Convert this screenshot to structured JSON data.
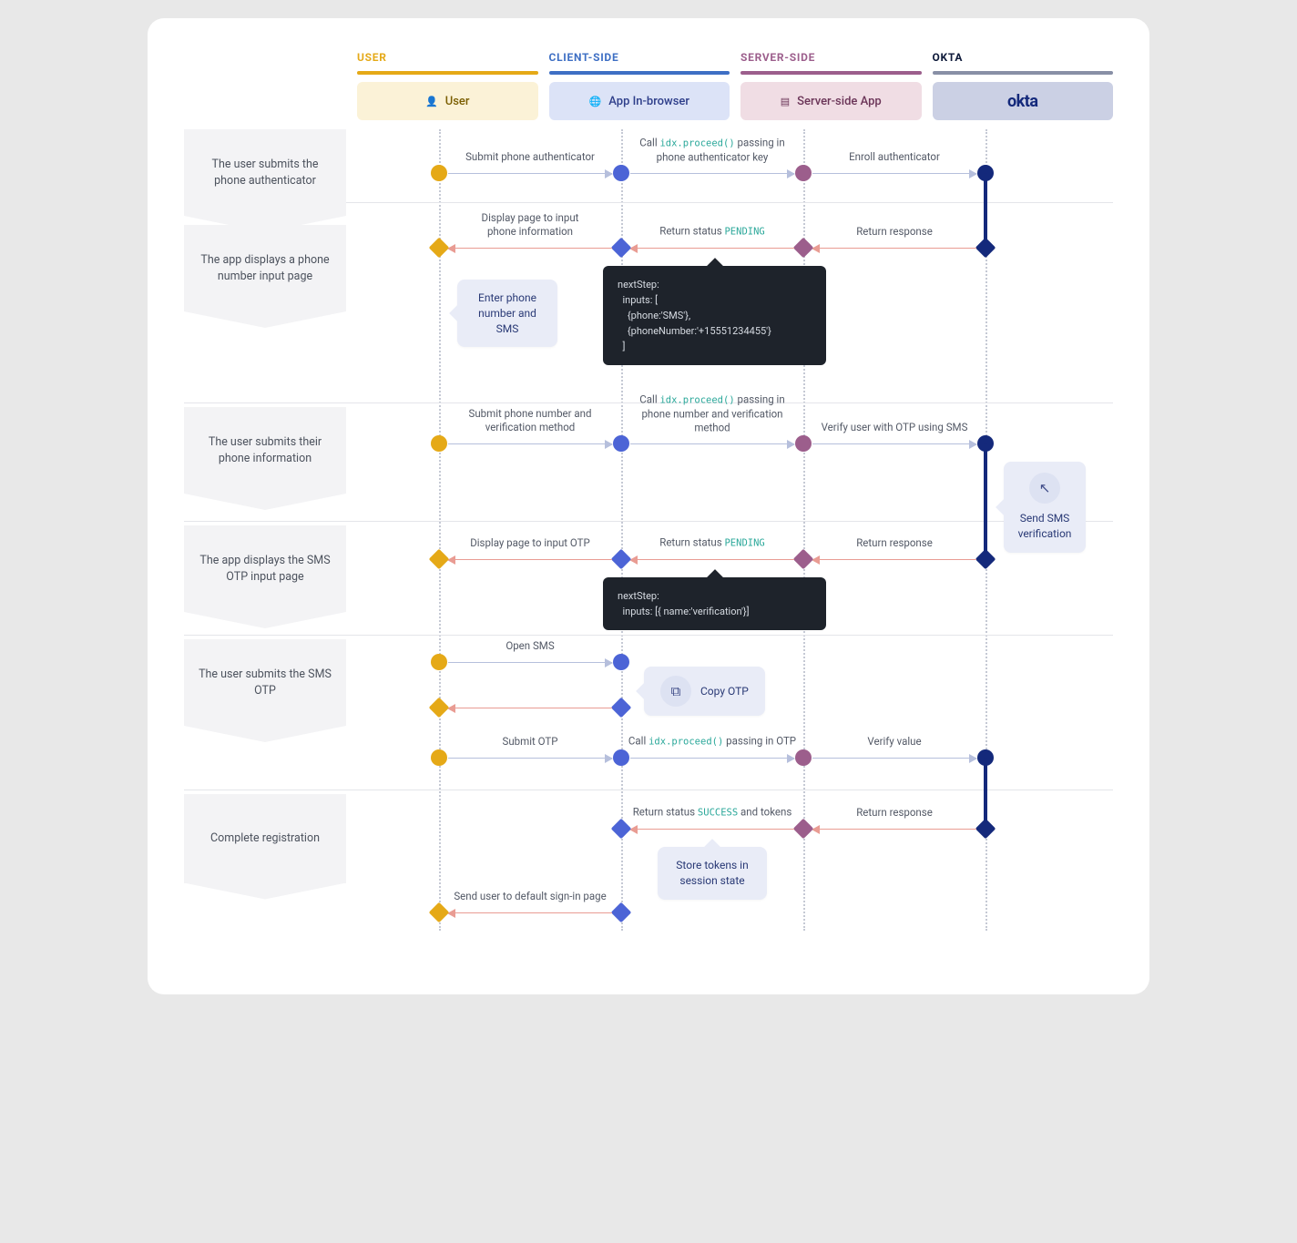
{
  "columns": {
    "user": {
      "label": "USER",
      "box": "User"
    },
    "client": {
      "label": "CLIENT-SIDE",
      "box": "App In-browser"
    },
    "server": {
      "label": "SERVER-SIDE",
      "box": "Server-side App"
    },
    "okta": {
      "label": "OKTA",
      "box": "okta"
    }
  },
  "steps": [
    "The user submits the phone authenticator",
    "The app displays a phone number input page",
    "The user submits their phone information",
    "The app displays the SMS OTP input page",
    "The user submits the SMS OTP",
    "Complete registration"
  ],
  "labels": {
    "l1_user_client": "Submit phone authenticator",
    "l1_client_server_pre": "Call ",
    "l1_client_server_code": "idx.proceed()",
    "l1_client_server_post": " passing in phone authenticator key",
    "l1_server_okta": "Enroll authenticator",
    "r1_okta_server": "Return response",
    "r1_server_client_pre": "Return status ",
    "r1_server_client_code": "PENDING",
    "r1_client_user": "Display page to input phone information",
    "callout_enter_phone": "Enter phone number and SMS",
    "code1": "nextStep:\n  inputs: [\n    {phone:'SMS'},\n    {phoneNumber:'+15551234455'}\n  ]",
    "l2_user_client": "Submit phone number and verification method",
    "l2_client_server_pre": "Call ",
    "l2_client_server_code": "idx.proceed()",
    "l2_client_server_post": " passing in phone number and verification method",
    "l2_server_okta": "Verify user with OTP using SMS",
    "callout_send_sms": "Send SMS verification",
    "r2_okta_server": "Return response",
    "r2_server_client_pre": "Return status ",
    "r2_server_client_code": "PENDING",
    "r2_client_user": "Display page to input OTP",
    "code2": "nextStep:\n  inputs: [{ name:'verification'}]",
    "l3_user_client_open": "Open SMS",
    "callout_copy_otp": "Copy OTP",
    "r3_client_user_back": "",
    "l3_user_client_submit": "Submit OTP",
    "l3_client_server_pre": "Call ",
    "l3_client_server_code": "idx.proceed()",
    "l3_client_server_post": " passing in OTP",
    "l3_server_okta": "Verify value",
    "r4_okta_server": "Return response",
    "r4_server_client_pre": "Return status ",
    "r4_server_client_code": "SUCCESS",
    "r4_server_client_post": " and tokens",
    "callout_store_tokens": "Store tokens in session state",
    "r4_client_user": "Send user to default sign-in page"
  },
  "chart_data": {
    "type": "sequence-diagram",
    "participants": [
      "User",
      "App In-browser (Client-side)",
      "Server-side App",
      "Okta"
    ],
    "phases": [
      {
        "title": "The user submits the phone authenticator",
        "messages": [
          {
            "from": "User",
            "to": "Client",
            "text": "Submit phone authenticator"
          },
          {
            "from": "Client",
            "to": "Server",
            "text": "Call idx.proceed() passing in phone authenticator key"
          },
          {
            "from": "Server",
            "to": "Okta",
            "text": "Enroll authenticator"
          }
        ]
      },
      {
        "title": "The app displays a phone number input page",
        "messages": [
          {
            "from": "Okta",
            "to": "Server",
            "text": "Return response"
          },
          {
            "from": "Server",
            "to": "Client",
            "text": "Return status PENDING",
            "payload": "nextStep: inputs: [ {phone:'SMS'}, {phoneNumber:'+15551234455'} ]"
          },
          {
            "from": "Client",
            "to": "User",
            "text": "Display page to input phone information"
          }
        ],
        "user_note": "Enter phone number and SMS"
      },
      {
        "title": "The user submits their phone information",
        "messages": [
          {
            "from": "User",
            "to": "Client",
            "text": "Submit phone number and verification method"
          },
          {
            "from": "Client",
            "to": "Server",
            "text": "Call idx.proceed() passing in phone number and verification method"
          },
          {
            "from": "Server",
            "to": "Okta",
            "text": "Verify user with OTP using SMS"
          }
        ],
        "okta_note": "Send SMS verification"
      },
      {
        "title": "The app displays the SMS OTP input page",
        "messages": [
          {
            "from": "Okta",
            "to": "Server",
            "text": "Return response"
          },
          {
            "from": "Server",
            "to": "Client",
            "text": "Return status PENDING",
            "payload": "nextStep: inputs: [{ name:'verification'}]"
          },
          {
            "from": "Client",
            "to": "User",
            "text": "Display page to input OTP"
          }
        ]
      },
      {
        "title": "The user submits the SMS OTP",
        "messages": [
          {
            "from": "User",
            "to": "Client",
            "text": "Open SMS"
          },
          {
            "note_at": "Client",
            "text": "Copy OTP"
          },
          {
            "from": "Client",
            "to": "User",
            "text": ""
          },
          {
            "from": "User",
            "to": "Client",
            "text": "Submit OTP"
          },
          {
            "from": "Client",
            "to": "Server",
            "text": "Call idx.proceed() passing in OTP"
          },
          {
            "from": "Server",
            "to": "Okta",
            "text": "Verify value"
          }
        ]
      },
      {
        "title": "Complete registration",
        "messages": [
          {
            "from": "Okta",
            "to": "Server",
            "text": "Return response"
          },
          {
            "from": "Server",
            "to": "Client",
            "text": "Return status SUCCESS and tokens"
          },
          {
            "note_at": "Client",
            "text": "Store tokens in session state"
          },
          {
            "from": "Client",
            "to": "User",
            "text": "Send user to default sign-in page"
          }
        ]
      }
    ]
  }
}
